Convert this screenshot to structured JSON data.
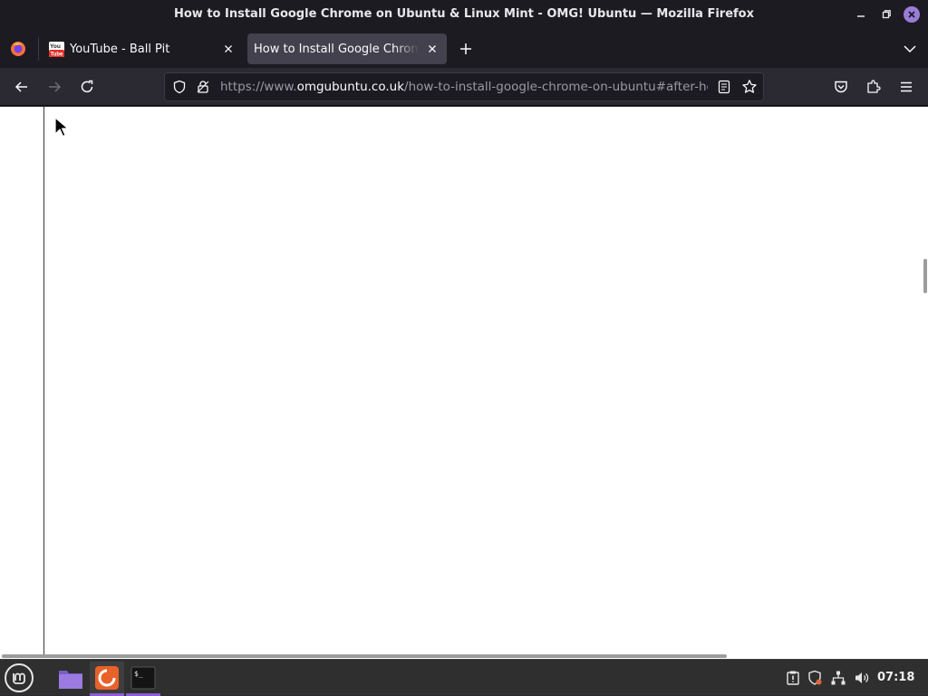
{
  "window": {
    "title": "How to Install Google Chrome on Ubuntu & Linux Mint - OMG! Ubuntu — Mozilla Firefox"
  },
  "tabs": [
    {
      "label": "YouTube - Ball Pit",
      "favicon": "youtube-icon",
      "active": false
    },
    {
      "label": "How to Install Google Chrome on Ubuntu & Linux Mint - OMG! Ubuntu",
      "favicon": "none",
      "active": true
    }
  ],
  "urlbar": {
    "prefix": "https://www.",
    "host": "omgubuntu.co.uk",
    "path": "/how-to-install-google-chrome-on-ubuntu#after-head"
  },
  "taskbar": {
    "clock": "07:18",
    "apps": [
      "files-icon",
      "firefox-icon",
      "terminal-icon"
    ]
  },
  "colors": {
    "chrome_dark": "#1c1b22",
    "toolbar": "#2b2a33",
    "active_tab": "#42414d",
    "accent_purple": "#8c5cd1",
    "content_bg": "#ffffff"
  }
}
